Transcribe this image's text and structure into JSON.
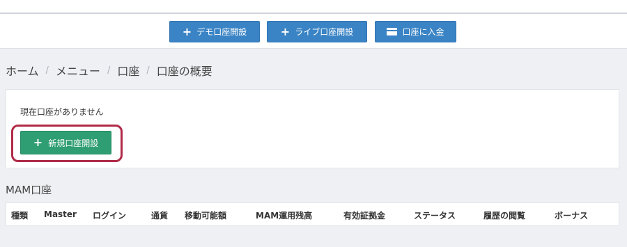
{
  "toolbar": {
    "demo_account_label": "デモ口座開設",
    "live_account_label": "ライブ口座開設",
    "deposit_label": "口座に入金",
    "plus_glyph": "+"
  },
  "breadcrumb": {
    "items": [
      "ホーム",
      "メニュー",
      "口座",
      "口座の概要"
    ],
    "separator": "/"
  },
  "accounts_panel": {
    "empty_message": "現在口座がありません",
    "new_account_label": "新規口座開設"
  },
  "mam": {
    "title": "MAM口座",
    "columns": [
      "種類",
      "Master",
      "ログイン",
      "通貨",
      "移動可能額",
      "MAM運用残高",
      "有効証拠金",
      "ステータス",
      "履歴の閲覧",
      "ボーナス"
    ]
  },
  "colors": {
    "primary_button": "#3a84c5",
    "success_button": "#2f9e73",
    "highlight_ring": "#b02a47",
    "page_background": "#eef0f4"
  }
}
